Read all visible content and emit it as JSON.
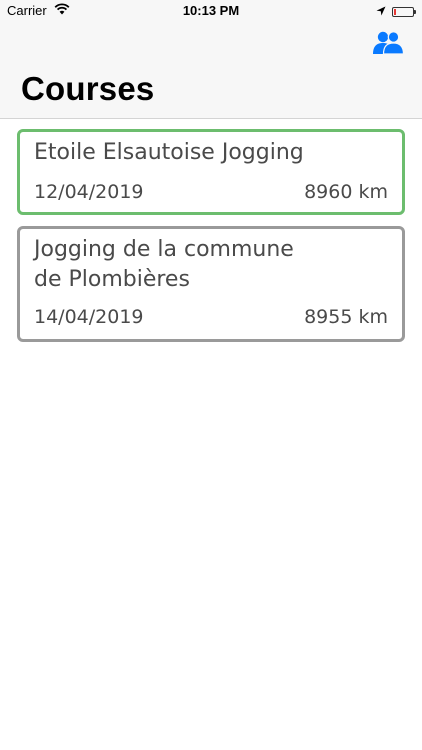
{
  "status_bar": {
    "carrier": "Carrier",
    "time": "10:13 PM",
    "icons": [
      "wifi-icon",
      "location-icon",
      "battery-icon"
    ],
    "battery_color": "#e53935"
  },
  "nav": {
    "title": "Courses",
    "right_icon": "people-icon",
    "accent_color": "#0a7aff"
  },
  "courses": [
    {
      "name": "Etoile Elsautoise Jogging",
      "date": "12/04/2019",
      "distance": "8960 km",
      "selected": true
    },
    {
      "name": "Jogging de la commune de Plombières",
      "date": "14/04/2019",
      "distance": "8955 km",
      "selected": false
    }
  ],
  "colors": {
    "selected_border": "#6cbd6e",
    "card_border": "#9a9a9a"
  }
}
